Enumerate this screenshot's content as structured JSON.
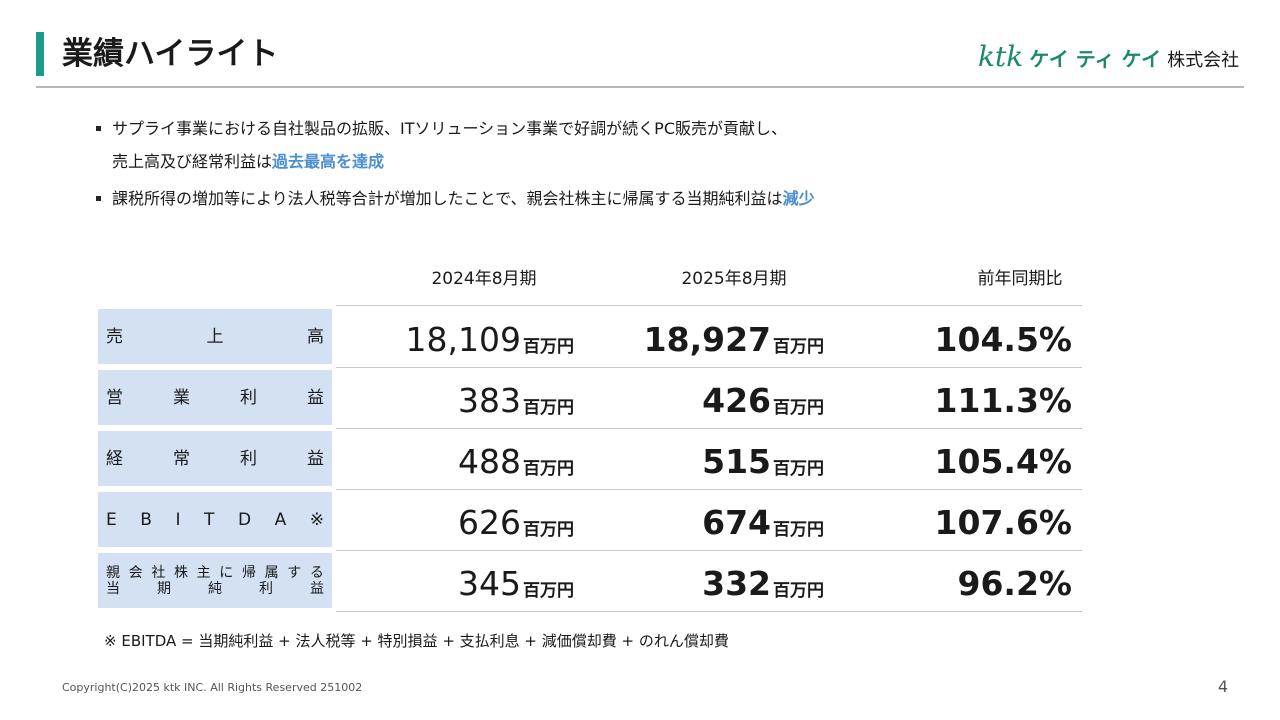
{
  "header": {
    "title": "業績ハイライト",
    "logo_ktk": "ktk",
    "logo_kana": "ケイ ティ ケイ",
    "logo_corp": "株式会社",
    "accent_color": "#1a9a8a"
  },
  "bullets": [
    {
      "line1": "サプライ事業における自社製品の拡販、ITソリューション事業で好調が続くPC販売が貢献し、",
      "line2_pre": "売上高及び経常利益は",
      "line2_hl": "過去最高を達成"
    },
    {
      "pre": "課税所得の増加等により法人税等合計が増加したことで、親会社株主に帰属する当期純利益は",
      "hl": "減少"
    }
  ],
  "table": {
    "columns": [
      "2024年8月期",
      "2025年8月期",
      "前年同期比"
    ],
    "unit": "百万円",
    "rows": [
      {
        "label_chars": [
          "売",
          "上",
          "高"
        ],
        "prev": "18,109",
        "curr": "18,927",
        "ratio": "104.5%"
      },
      {
        "label_chars": [
          "営",
          "業",
          "利",
          "益"
        ],
        "prev": "383",
        "curr": "426",
        "ratio": "111.3%"
      },
      {
        "label_chars": [
          "経",
          "常",
          "利",
          "益"
        ],
        "prev": "488",
        "curr": "515",
        "ratio": "105.4%"
      },
      {
        "label_chars": [
          "E",
          "B",
          "I",
          "T",
          "D",
          "A",
          "※"
        ],
        "prev": "626",
        "curr": "674",
        "ratio": "107.6%"
      },
      {
        "label_line1": [
          "親",
          "会",
          "社",
          "株",
          "主",
          "に",
          "帰",
          "属",
          "す",
          "る"
        ],
        "label_line2": [
          "当",
          "期",
          "純",
          "利",
          "益"
        ],
        "prev": "345",
        "curr": "332",
        "ratio": "96.2%"
      }
    ]
  },
  "footnote": "※ EBITDA = 当期純利益 + 法人税等 + 特別損益 + 支払利息 + 減価償却費 + のれん償却費",
  "copyright": "Copyright(C)2025 ktk INC. All Rights Reserved  251002",
  "page_number": "4",
  "highlight_color": "#4a8fd0",
  "label_bg_color": "#d4e1f2"
}
